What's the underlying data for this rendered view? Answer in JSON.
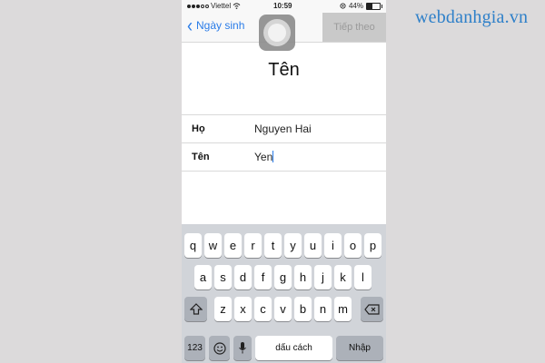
{
  "watermark": "webdanhgia.vn",
  "status_bar": {
    "carrier": "Viettel",
    "time": "10:59",
    "battery": "44%"
  },
  "nav": {
    "back_label": "Ngày sinh",
    "next_label": "Tiếp theo"
  },
  "title": "Tên",
  "form": {
    "fields": [
      {
        "label": "Họ",
        "value": "Nguyen Hai"
      },
      {
        "label": "Tên",
        "value": "Yen"
      }
    ]
  },
  "keyboard": {
    "row1": [
      "q",
      "w",
      "e",
      "r",
      "t",
      "y",
      "u",
      "i",
      "o",
      "p"
    ],
    "row2": [
      "a",
      "s",
      "d",
      "f",
      "g",
      "h",
      "j",
      "k",
      "l"
    ],
    "row3": [
      "z",
      "x",
      "c",
      "v",
      "b",
      "n",
      "m"
    ],
    "numbers_key": "123",
    "space_key": "dấu cách",
    "return_key": "Nhập"
  },
  "icons": [
    "chevron-left-icon",
    "wifi-icon",
    "battery-icon",
    "shift-icon",
    "backspace-icon",
    "emoji-icon",
    "microphone-icon"
  ]
}
